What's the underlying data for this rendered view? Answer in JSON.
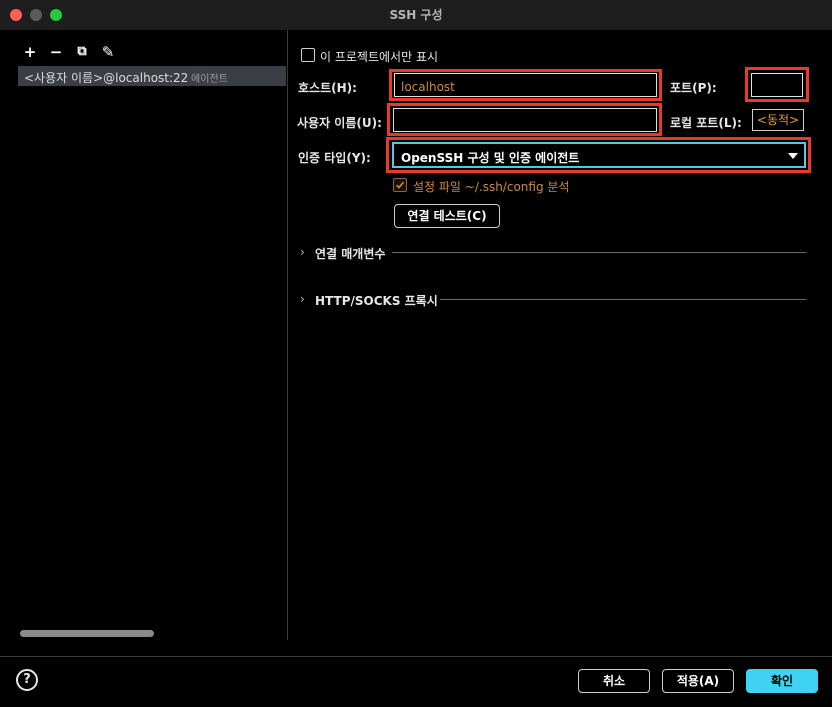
{
  "window": {
    "title": "SSH 구성"
  },
  "left": {
    "toolbar": {
      "add": "+",
      "remove": "−",
      "copy": "⧉",
      "edit": "✎"
    },
    "items": [
      {
        "label": "<사용자 이름>@localhost:22",
        "sub": "에이전트"
      }
    ]
  },
  "form": {
    "project_only": "이 프로젝트에서만 표시",
    "host_label": "호스트(H):",
    "host_value": "localhost",
    "port_label": "포트(P):",
    "port_value": "",
    "user_label": "사용자 이름(U):",
    "user_value": "",
    "local_port_label": "로컬 포트(L):",
    "local_port_value": "<동적>",
    "auth_label": "인증 타입(Y):",
    "auth_value": "OpenSSH 구성 및 인증 에이전트",
    "parse_config": "설정 파일 ~/.ssh/config 분석",
    "test_button": "연결 테스트(C)",
    "sections": [
      "연결 매개변수",
      "HTTP/SOCKS 프록시"
    ]
  },
  "footer": {
    "help": "?",
    "cancel": "취소",
    "apply": "적용(A)",
    "ok": "확인"
  },
  "colors": {
    "accent": "#3fd2f2",
    "highlight": "#e8392a",
    "value_text": "#d08a40"
  }
}
